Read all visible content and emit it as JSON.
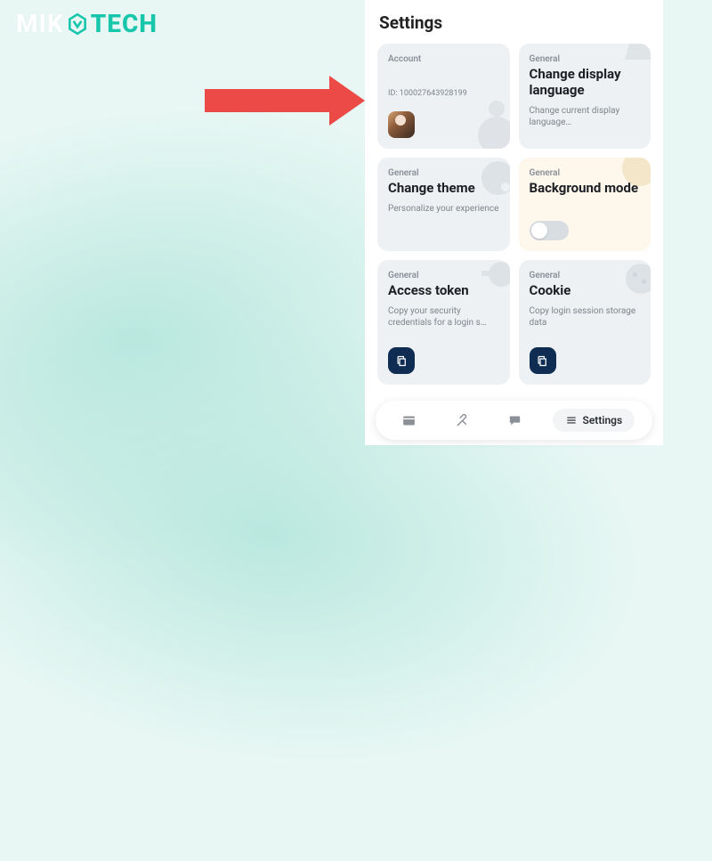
{
  "logo": {
    "part1": "MIK",
    "part2": "TECH"
  },
  "page": {
    "title": "Settings"
  },
  "cards": {
    "account": {
      "tag": "Account",
      "id_line": "ID: 100027643928199"
    },
    "language": {
      "tag": "General",
      "title": "Change display language",
      "desc": "Change current display language…"
    },
    "theme": {
      "tag": "General",
      "title": "Change theme",
      "desc": "Personalize your experience"
    },
    "bgmode": {
      "tag": "General",
      "title": "Background mode"
    },
    "token": {
      "tag": "General",
      "title": "Access token",
      "desc": "Copy your security credentials for a login s…"
    },
    "cookie": {
      "tag": "General",
      "title": "Cookie",
      "desc": "Copy login session storage data"
    }
  },
  "bottomnav": {
    "settings_label": "Settings"
  },
  "icons": {
    "hex": "hex-icon",
    "copy": "copy-icon",
    "browser": "browser-icon",
    "tools": "tools-icon",
    "chat": "chat-icon",
    "menu": "menu-icon"
  }
}
